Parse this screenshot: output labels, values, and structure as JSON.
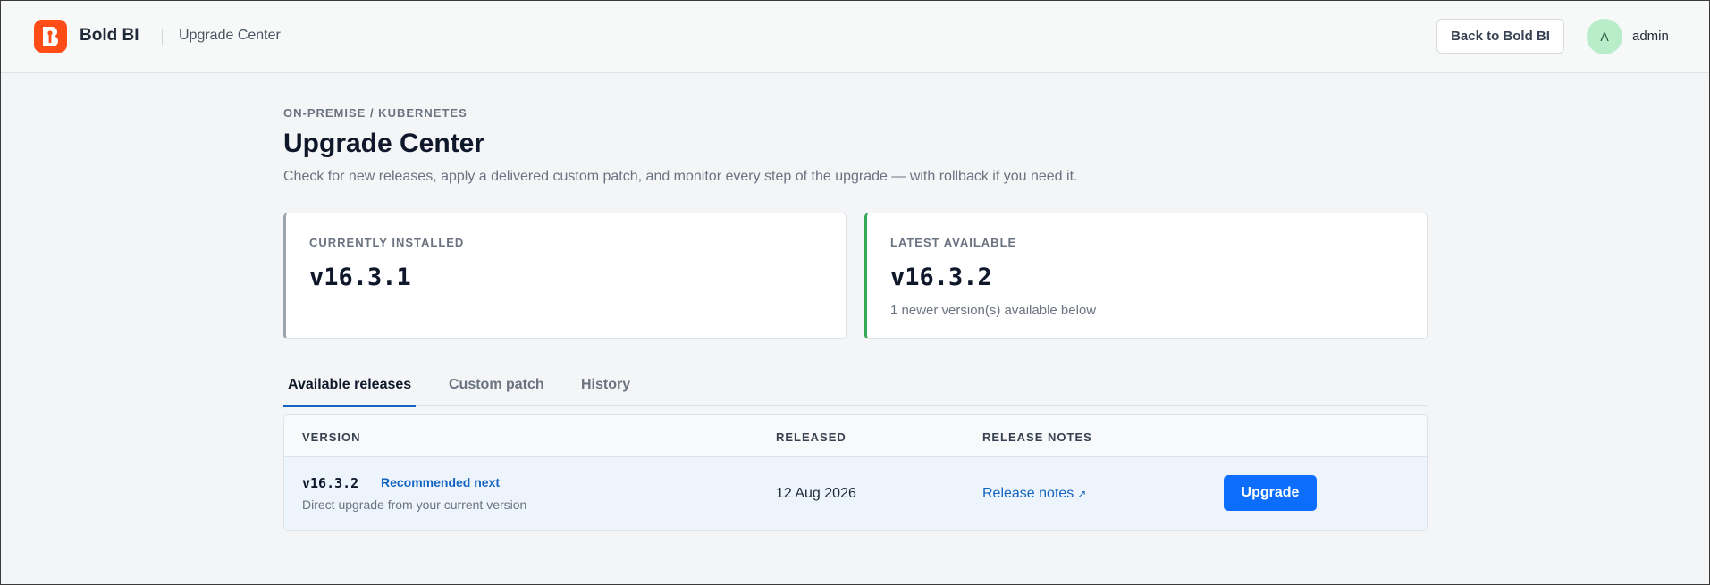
{
  "header": {
    "brand": "Bold BI",
    "section": "Upgrade Center",
    "back_label": "Back to Bold BI",
    "avatar_initial": "A",
    "user_name": "admin",
    "brand_color": "#ff4d17"
  },
  "page": {
    "eyebrow": "ON-PREMISE / KUBERNETES",
    "title": "Upgrade Center",
    "subtitle": "Check for new releases, apply a delivered custom patch, and monitor every step of the upgrade — with rollback if you need it."
  },
  "cards": {
    "installed": {
      "label": "CURRENTLY INSTALLED",
      "version": "v16.3.1"
    },
    "latest": {
      "label": "LATEST AVAILABLE",
      "version": "v16.3.2",
      "note": "1 newer version(s) available below",
      "accent": "#34a853"
    }
  },
  "tabs": [
    {
      "label": "Available releases",
      "active": true
    },
    {
      "label": "Custom patch",
      "active": false
    },
    {
      "label": "History",
      "active": false
    }
  ],
  "releases": {
    "columns": [
      "VERSION",
      "RELEASED",
      "RELEASE NOTES"
    ],
    "rows": [
      {
        "version": "v16.3.2",
        "badge": "Recommended next",
        "description": "Direct upgrade from your current version",
        "released": "12 Aug 2026",
        "notes_label": "Release notes",
        "notes_icon": "external-link-icon",
        "action_label": "Upgrade"
      }
    ]
  }
}
